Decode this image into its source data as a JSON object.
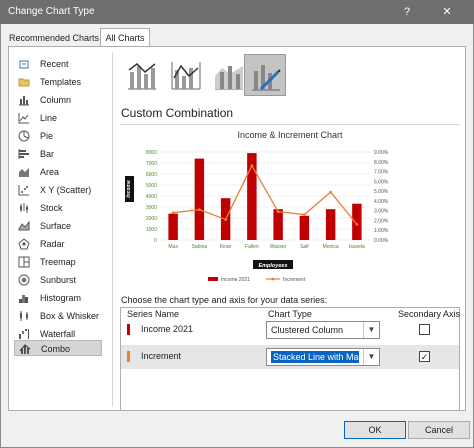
{
  "window": {
    "title": "Change Chart Type",
    "help": "?",
    "close": "✕"
  },
  "tabs": [
    {
      "label": "Recommended Charts"
    },
    {
      "label": "All Charts"
    }
  ],
  "sidebar": {
    "items": [
      {
        "label": "Recent",
        "icon": "recent-icon"
      },
      {
        "label": "Templates",
        "icon": "folder-icon"
      },
      {
        "label": "Column",
        "icon": "column-chart-icon"
      },
      {
        "label": "Line",
        "icon": "line-chart-icon"
      },
      {
        "label": "Pie",
        "icon": "pie-chart-icon"
      },
      {
        "label": "Bar",
        "icon": "bar-chart-icon"
      },
      {
        "label": "Area",
        "icon": "area-chart-icon"
      },
      {
        "label": "X Y (Scatter)",
        "icon": "scatter-chart-icon"
      },
      {
        "label": "Stock",
        "icon": "stock-chart-icon"
      },
      {
        "label": "Surface",
        "icon": "surface-chart-icon"
      },
      {
        "label": "Radar",
        "icon": "radar-chart-icon"
      },
      {
        "label": "Treemap",
        "icon": "treemap-chart-icon"
      },
      {
        "label": "Sunburst",
        "icon": "sunburst-chart-icon"
      },
      {
        "label": "Histogram",
        "icon": "histogram-chart-icon"
      },
      {
        "label": "Box & Whisker",
        "icon": "box-whisker-chart-icon"
      },
      {
        "label": "Waterfall",
        "icon": "waterfall-chart-icon"
      },
      {
        "label": "Combo",
        "icon": "combo-chart-icon"
      }
    ],
    "selected": "Combo"
  },
  "section_title": "Custom Combination",
  "chart_data": {
    "type": "bar",
    "title": "Income & Increment Chart",
    "xlabel": "Employees",
    "ylabel": "Income",
    "categories": [
      "Max",
      "Sabina",
      "Kiran",
      "Fallen",
      "Wasser",
      "Saif",
      "Monica",
      "Isavela"
    ],
    "y_ticks": [
      "0",
      "1000",
      "2000",
      "3000",
      "4000",
      "5000",
      "6000",
      "7000",
      "8000"
    ],
    "y2_ticks": [
      "0.00%",
      "1.00%",
      "2.00%",
      "3.00%",
      "4.00%",
      "5.00%",
      "6.00%",
      "7.00%",
      "8.00%",
      "9.00%"
    ],
    "ylim": [
      0,
      8000
    ],
    "y2lim": [
      0,
      9
    ],
    "series": [
      {
        "name": "Income 2021",
        "type": "bar",
        "axis": "primary",
        "color": "#c00000",
        "values": [
          2400,
          7400,
          3800,
          7900,
          2800,
          2200,
          2800,
          3300
        ]
      },
      {
        "name": "Increment",
        "type": "line",
        "axis": "secondary",
        "color": "#ed7d31",
        "values": [
          2.8,
          3.1,
          2.1,
          7.6,
          2.9,
          2.6,
          4.9,
          1.6
        ]
      }
    ],
    "legend": "bottom",
    "grid": true
  },
  "series_table": {
    "instruction": "Choose the chart type and axis for your data series:",
    "headers": {
      "name": "Series Name",
      "type": "Chart Type",
      "axis": "Secondary Axis"
    },
    "rows": [
      {
        "name": "Income 2021",
        "chart_type": "Clustered Column",
        "secondary": false,
        "color": "#c00000"
      },
      {
        "name": "Increment",
        "chart_type": "Stacked Line with Ma...",
        "secondary": true,
        "color": "#ed7d31"
      }
    ]
  },
  "buttons": {
    "ok": "OK",
    "cancel": "Cancel"
  }
}
